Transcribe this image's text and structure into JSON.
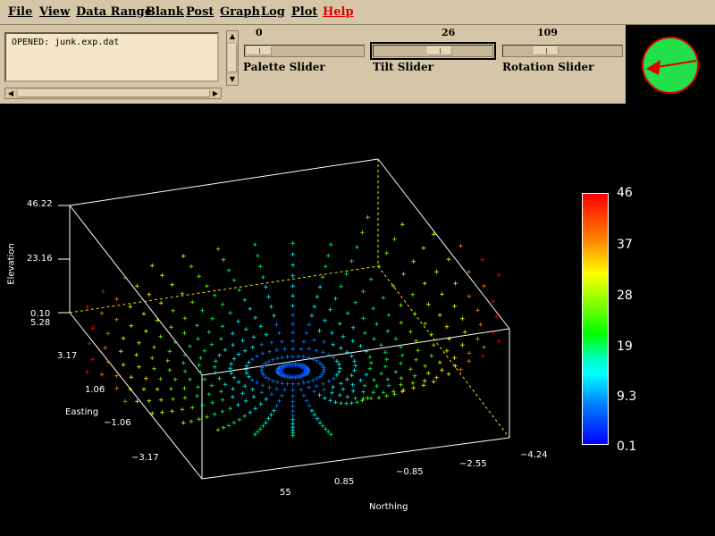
{
  "menu": {
    "items": [
      {
        "label": "File"
      },
      {
        "label": "View"
      },
      {
        "label": "Data Range"
      },
      {
        "label": "Blank"
      },
      {
        "label": "Post"
      },
      {
        "label": "Graph"
      },
      {
        "label": "Log"
      },
      {
        "label": "Plot"
      },
      {
        "label": "Help"
      }
    ]
  },
  "log": {
    "text": "OPENED: junk.exp.dat"
  },
  "sliders": {
    "palette": {
      "value": "0",
      "label": "Palette Slider",
      "position": 0.0
    },
    "tilt": {
      "value": "26",
      "label": "Tilt Slider",
      "position": 0.55
    },
    "rotation": {
      "value": "109",
      "label": "Rotation Slider",
      "position": 0.3
    }
  },
  "compass": {
    "icon": "compass-arrow-icon",
    "background": "#22e04a",
    "arrow_color": "#e00000"
  },
  "plot": {
    "elevation_axis": {
      "label": "Elevation",
      "ticks": [
        "46.22",
        "23.16",
        "0.10"
      ]
    },
    "easting_axis": {
      "label": "Easting",
      "ticks": [
        "5.28",
        "3.17",
        "1.06",
        "−1.06",
        "−3.17"
      ]
    },
    "northing_axis": {
      "label": "Northing",
      "ticks": [
        "55",
        "0.85",
        "−0.85",
        "−2.55",
        "−4.24"
      ]
    },
    "colorbar": {
      "ticks": [
        "46",
        "37",
        "28",
        "19",
        "9.3",
        "0.1"
      ]
    }
  }
}
